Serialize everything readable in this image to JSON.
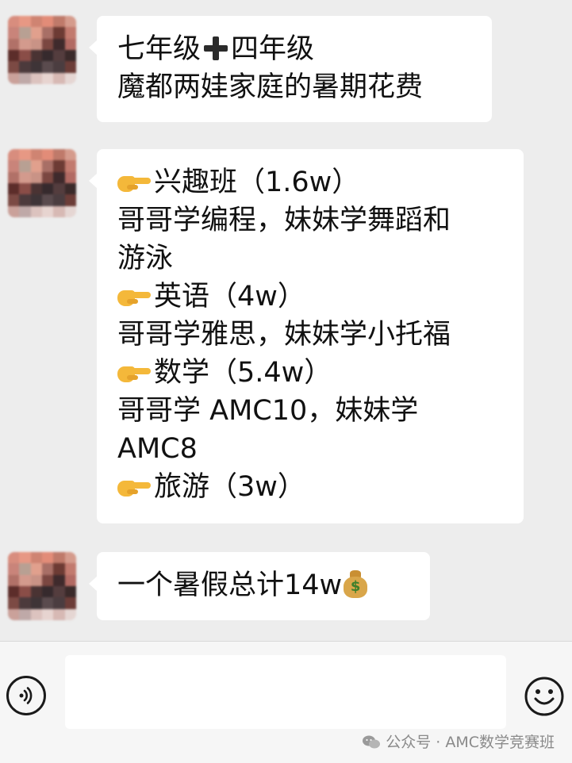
{
  "messages": [
    {
      "lines": [
        {
          "pre": "七年级",
          "post": "四年级"
        },
        {
          "text": "魔都两娃家庭的暑期花费"
        }
      ]
    },
    {
      "lines": [
        {
          "text": "兴趣班（1.6w）",
          "pointer": true
        },
        {
          "text": "哥哥学编程，妹妹学舞蹈和"
        },
        {
          "text": "游泳"
        },
        {
          "text": "英语（4w）",
          "pointer": true
        },
        {
          "text": "哥哥学雅思，妹妹学小托福"
        },
        {
          "text": "数学（5.4w）",
          "pointer": true
        },
        {
          "text": "哥哥学 AMC10，妹妹学"
        },
        {
          "text": "AMC8"
        },
        {
          "text": "旅游（3w）",
          "pointer": true
        }
      ]
    },
    {
      "lines": [
        {
          "text": "一个暑假总计14w"
        }
      ]
    }
  ],
  "icons": {
    "pointer": "backhand-index-pointing-right-icon",
    "cross": "heavy-plus-icon",
    "money": "money-bag-icon",
    "voice": "voice-input-icon",
    "emoji": "smiley-face-icon",
    "wechat": "wechat-logo-icon"
  },
  "input_bar": {
    "text_value": "",
    "watermark": "公众号 · AMC数学竞赛班"
  },
  "colors": {
    "background": "#ededed",
    "bubble": "#ffffff",
    "input_bar": "#f6f6f6"
  }
}
